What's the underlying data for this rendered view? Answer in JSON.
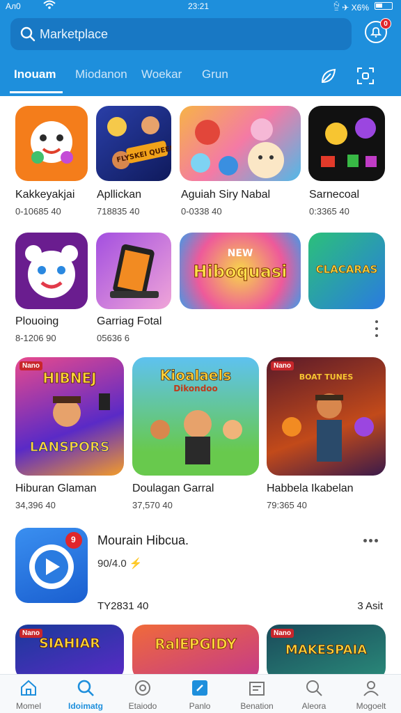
{
  "status_bar": {
    "left": "Ал0",
    "time": "23:21",
    "right": "ꊁ ✈ X6%"
  },
  "search": {
    "placeholder": "Marketplace"
  },
  "notifications": {
    "badge": "0"
  },
  "tabs": [
    {
      "label": "Inouam",
      "active": true
    },
    {
      "label": "Miodanon",
      "active": false
    },
    {
      "label": "Woekar",
      "active": false
    },
    {
      "label": "Grun",
      "active": false
    }
  ],
  "row1": [
    {
      "name": "Kakkeyakjai",
      "meta": "0-10685 40",
      "icon": "cartoon-face-icon"
    },
    {
      "name": "Apllickan",
      "meta": "718835 40",
      "banner": "FLYSKEI QUEEN"
    },
    {
      "name": "Aguiah Siry Nabal",
      "meta": "0-0338 40",
      "icon": "cartoon-animals-icon"
    },
    {
      "name": "Sarnecoal",
      "meta": "0:3365 40",
      "icon": "game-pieces-icon"
    }
  ],
  "row2": [
    {
      "name": "Plouoing",
      "meta": "8-1206 90",
      "icon": "bear-face-icon"
    },
    {
      "name": "Garriag Fotal",
      "meta": "05636 6",
      "icon": "tablet-icon"
    },
    {
      "name": "",
      "meta": "",
      "banner": "Hiboquasi",
      "banner_top": "NEW"
    },
    {
      "name": "",
      "meta": "",
      "banner": "CLACARAS"
    }
  ],
  "row3": [
    {
      "name": "Hiburan Glaman",
      "meta": "34,396 40",
      "banner": "HIBNEJ",
      "banner2": "LANSPORS",
      "tag": "Nano"
    },
    {
      "name": "Doulagan Garral",
      "meta": "37,570 40",
      "banner": "Kioalaels",
      "banner2": "Dikondoo"
    },
    {
      "name": "Habbela Ikabelan",
      "meta": "79:365 40",
      "tag": "Nano",
      "banner": "BOAT TUNES"
    }
  ],
  "featured": {
    "title": "Mourain Hibcua.",
    "meta": "90/4.0 ⚡",
    "left": "TY2831 40",
    "right": "3 Asit",
    "icon": "video-chat-icon",
    "badge": "9"
  },
  "row4": [
    {
      "tag": "Nano",
      "banner": "SIAHIAR"
    },
    {
      "banner": "RalEPGIDY"
    },
    {
      "tag": "Nano",
      "banner": "MAKESPAIA"
    }
  ],
  "bottom_nav": [
    {
      "label": "Momel",
      "icon": "home-icon",
      "active": false
    },
    {
      "label": "Idoimatg",
      "icon": "search-icon",
      "active": true
    },
    {
      "label": "Etaiodo",
      "icon": "discover-icon",
      "active": false
    },
    {
      "label": "Panlo",
      "icon": "apps-icon",
      "active": false
    },
    {
      "label": "Benation",
      "icon": "library-icon",
      "active": false
    },
    {
      "label": "Aleora",
      "icon": "find-icon",
      "active": false
    },
    {
      "label": "Mogoelt",
      "icon": "profile-icon",
      "active": false
    }
  ],
  "colors": {
    "brand": "#1e8fdc",
    "search_bg": "#1878c4",
    "badge": "#e0262b"
  }
}
